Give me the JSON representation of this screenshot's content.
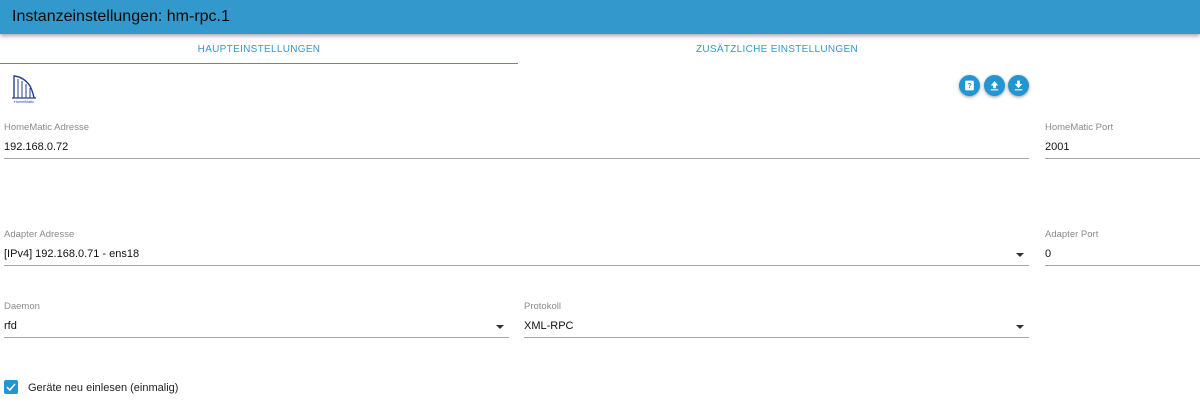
{
  "window": {
    "title": "Instanzeinstellungen: hm-rpc.1"
  },
  "tabs": [
    {
      "label": "HAUPTEINSTELLUNGEN",
      "active": true
    },
    {
      "label": "ZUSÄTZLICHE EINSTELLUNGEN",
      "active": false
    }
  ],
  "logo": {
    "text": "HomeMatic"
  },
  "actions": [
    "help-icon",
    "upload-icon",
    "download-icon"
  ],
  "fields": {
    "homematic_address": {
      "label": "HomeMatic Adresse",
      "value": "192.168.0.72"
    },
    "homematic_port": {
      "label": "HomeMatic Port",
      "value": "2001"
    },
    "adapter_address": {
      "label": "Adapter Adresse",
      "value": "[IPv4] 192.168.0.71 - ens18"
    },
    "adapter_port": {
      "label": "Adapter Port",
      "value": "0"
    },
    "daemon": {
      "label": "Daemon",
      "value": "rfd"
    },
    "protocol": {
      "label": "Protokoll",
      "value": "XML-RPC"
    }
  },
  "checkbox": {
    "label": "Geräte neu einlesen (einmalig)",
    "checked": true
  },
  "colors": {
    "accent": "#3399cc",
    "button": "#2196d3"
  }
}
